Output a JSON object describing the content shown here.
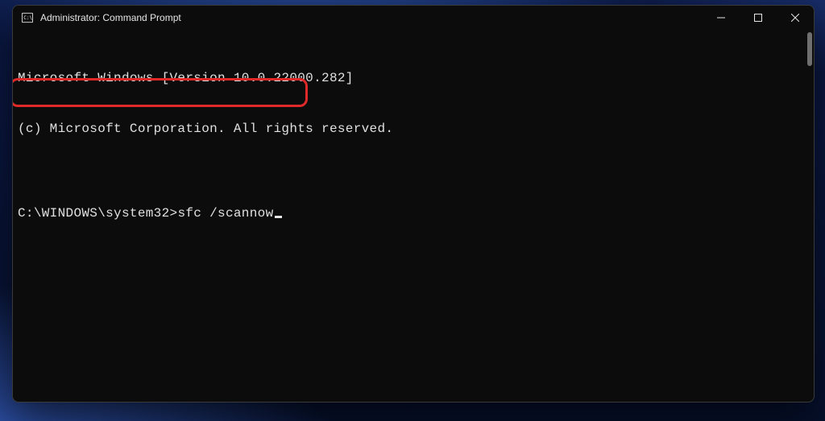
{
  "window": {
    "title": "Administrator: Command Prompt"
  },
  "terminal": {
    "line1": "Microsoft Windows [Version 10.0.22000.282]",
    "line2": "(c) Microsoft Corporation. All rights reserved.",
    "blank": "",
    "prompt": "C:\\WINDOWS\\system32>",
    "command": "sfc /scannow"
  },
  "annotation": {
    "highlight_color": "#e02a2a"
  }
}
